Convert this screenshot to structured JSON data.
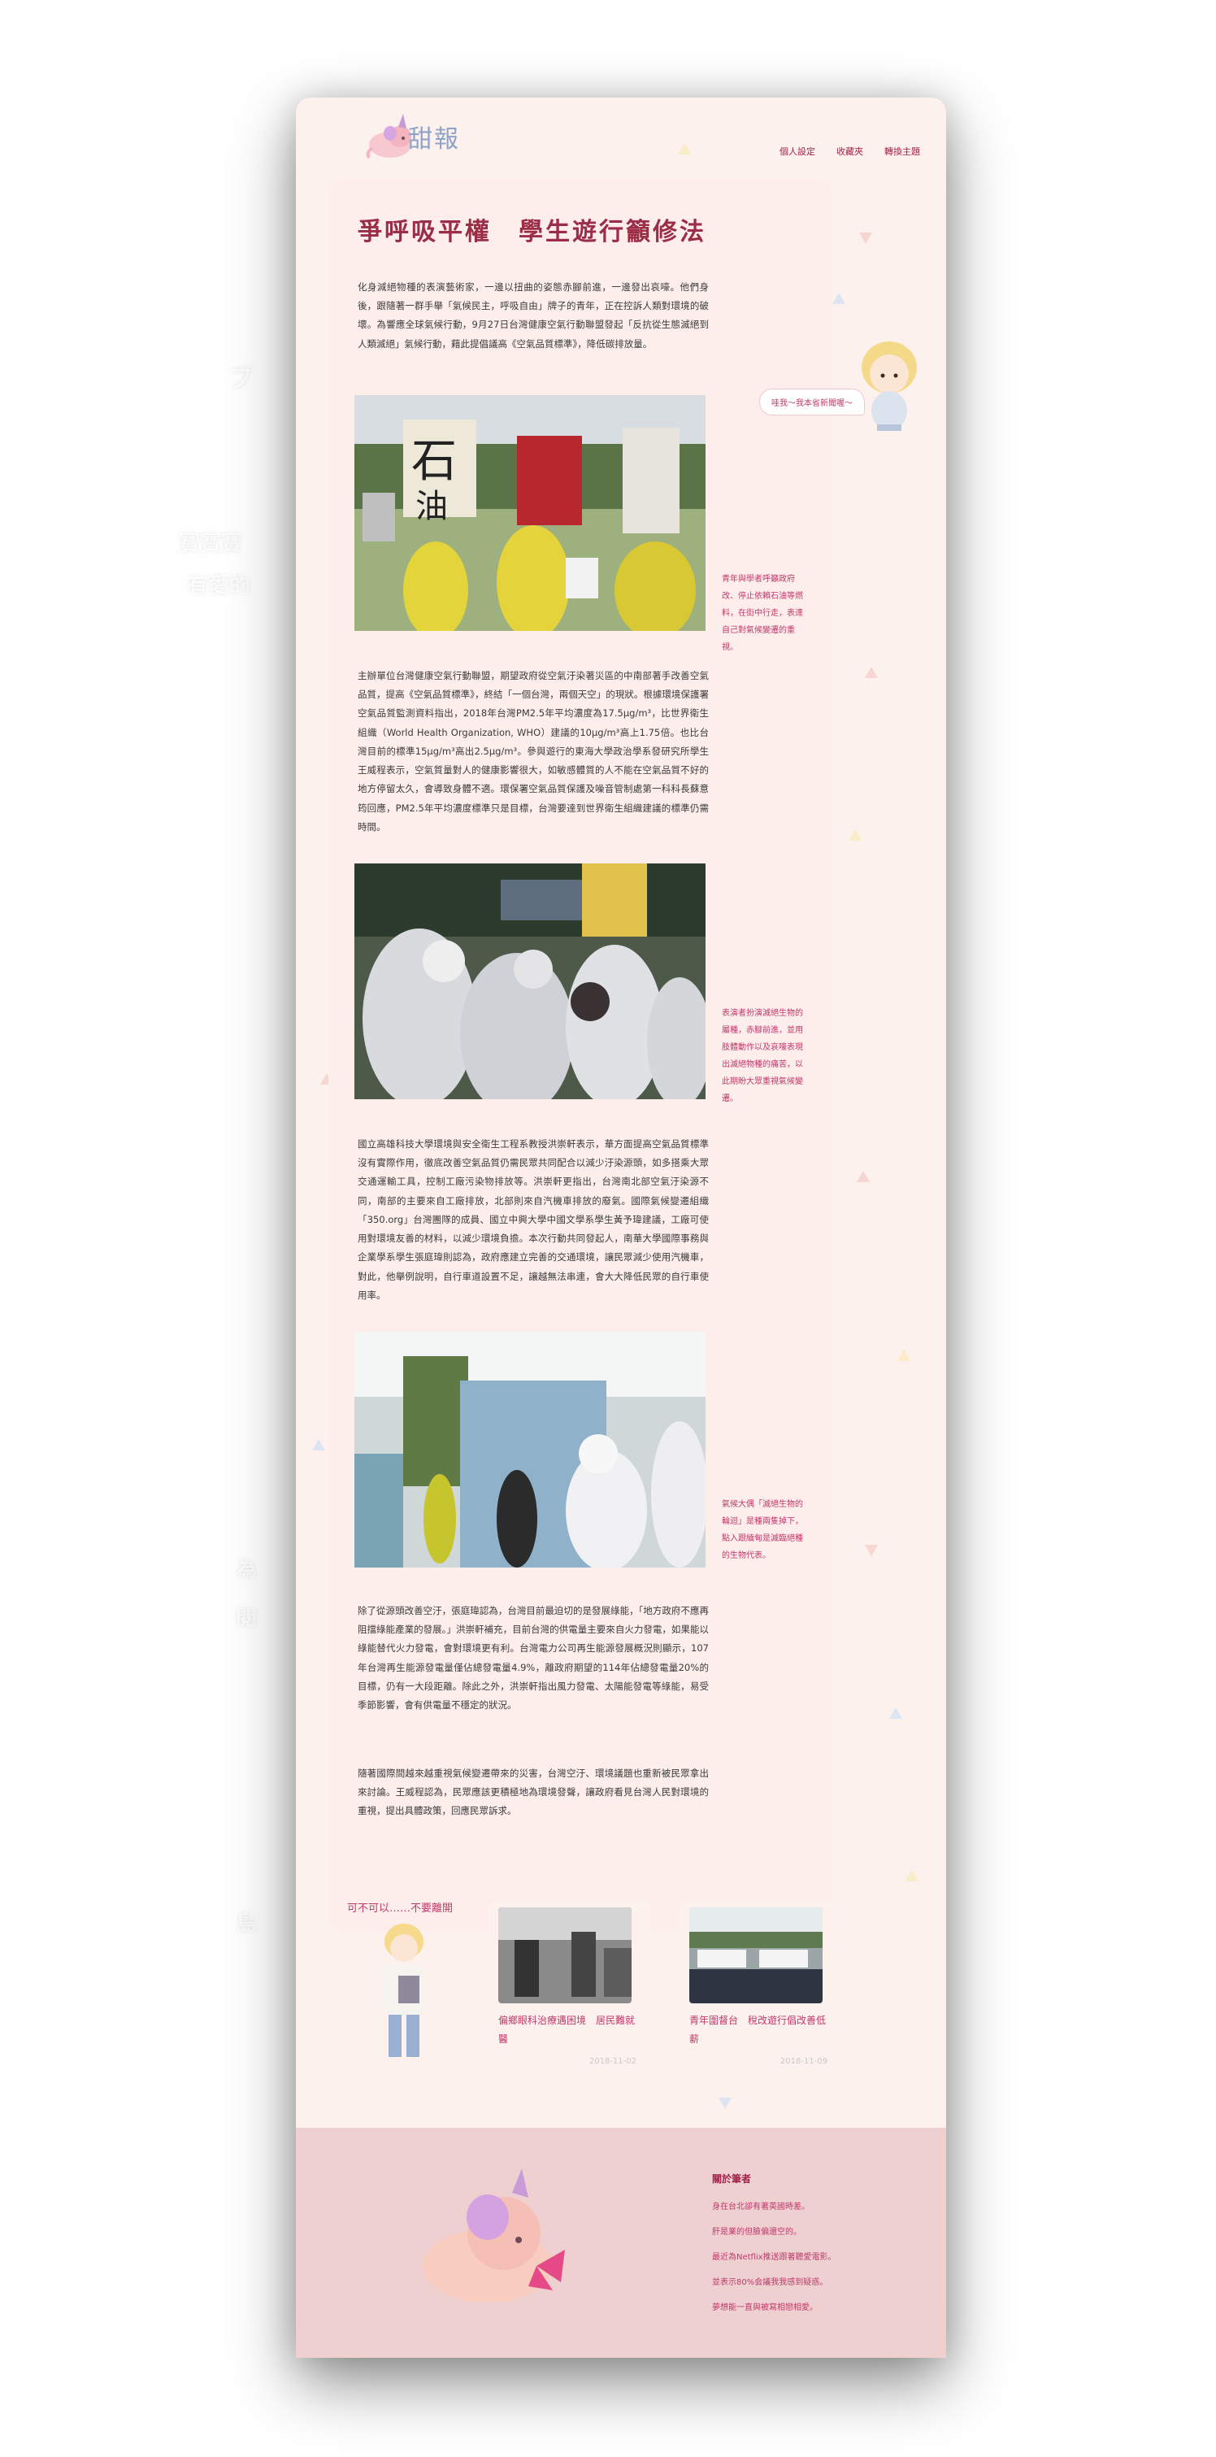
{
  "site": {
    "logo_text": "甜報"
  },
  "nav": [
    {
      "label": "個人設定"
    },
    {
      "label": "收藏夾"
    },
    {
      "label": "轉換主題"
    }
  ],
  "article": {
    "title": "爭呼吸平權　學生遊行籲修法",
    "intro": "化身減絕物種的表演藝術家，一邊以扭曲的姿態赤腳前進，一邊發出哀嚎。他們身後，跟隨著一群手舉「氣候民主，呼吸自由」牌子的青年，正在控訴人類對環境的破壞。為響應全球氣候行動，9月27日台灣健康空氣行動聯盟發起「反抗從生態滅絕到人類滅絕」氣候行動，藉此提倡議高《空氣品質標準》，降低碳排放量。",
    "para2": "主辦單位台灣健康空氣行動聯盟，期望政府從空氣汙染著災區的中南部著手改善空氣品質，提高《空氣品質標準》，終結「一個台灣，兩個天空」的現狀。根據環境保護署空氣品質監測資料指出，2018年台灣PM2.5年平均濃度為17.5μg/m³，比世界衛生組織（World Health Organization, WHO）建議的10μg/m³高上1.75倍。也比台灣目前的標準15μg/m³高出2.5μg/m³。參與遊行的東海大學政治學系發研究所學生王威程表示，空氣質量對人的健康影響很大，如敏感體質的人不能在空氣品質不好的地方停留太久，會導致身體不適。環保署空氣品質保護及噪音管制處第一科科長蘇意筠回應，PM2.5年平均濃度標準只是目標，台灣要達到世界衛生組織建議的標準仍需時間。",
    "para3": "國立高雄科技大學環境與安全衛生工程系教授洪崇軒表示，華方面提高空氣品質標準沒有實際作用，徹底改善空氣品質仍需民眾共同配合以減少汙染源頭，如多搭乘大眾交通運輸工具，控制工廠污染物排放等。洪崇軒更指出，台灣南北部空氣汙染源不同，南部的主要來自工廠排放，北部則來自汽機車排放的廢氣。國際氣候變遷組織「350.org」台灣團隊的成員、國立中興大學中國文學系學生黃予瑋建議，工廠可使用對環境友善的材料，以減少環境負擔。本次行動共同發起人，南華大學國際事務與企業學系學生張庭瑋則認為，政府應建立完善的交通環境，讓民眾減少使用汽機車，對此，他舉例說明，自行車道設置不足，讓越無法串連，會大大降低民眾的自行車使用率。",
    "para4": "除了從源頭改善空汙，張庭瑋認為，台灣目前最迫切的是發展綠能，「地方政府不應再阻擋綠能產業的發展。」洪崇軒補充，目前台灣的供電量主要來自火力發電，如果能以綠能替代火力發電，會對環境更有利。台灣電力公司再生能源發展概況則顯示，107年台灣再生能源發電量僅佔總發電量4.9%，離政府期望的114年佔總發電量20%的目標，仍有一大段距離。除此之外，洪崇軒指出風力發電、太陽能發電等綠能，易受季節影響，會有供電量不穩定的狀況。",
    "para5": "隨著國際間越來越重視氣候變遷帶來的災害，台灣空汙、環境議題也重新被民眾拿出來討論。王威程認為，民眾應該更積極地為環境發聲，讓政府看見台灣人民對環境的重視，提出具體政策，回應民眾訴求。",
    "captions": [
      "青年與學者呼籲政府改、停止依賴石油等燃料，在街中行走，表達自己對氣候變遷的重視。",
      "表演者扮演滅絕生物的屬種，赤腳前進，並用肢體動作以及哀嚎表現出滅絕物種的痛苦，以此期盼大眾重視氣候變遷。",
      "氣候大偶「滅絕生物的輪迴」是種兩隻掉下，點入跟緬甸是滅臨絕種的生物代表。"
    ],
    "speech_bubble": "哇我～我本省新聞喔～"
  },
  "related": {
    "label": "可不可以……不要離開",
    "items": [
      {
        "title": "偏鄉眼科治療遇困境　居民難就醫",
        "date": "2018-11-02"
      },
      {
        "title": "青年圍督台　稅改遊行倡改善低薪",
        "date": "2018-11-09"
      }
    ]
  },
  "footer": {
    "title": "關於筆者",
    "items": [
      "身在台北卻有著英國時差。",
      "肝是業的但臉偏還空的。",
      "最近為Netflix推送跟著聽愛電影。",
      "並表示80%会議我我感到疑惑。",
      "夢想能一直與被寫相戀相愛。"
    ]
  },
  "background_text": [
    "プ",
    "寶寶寶",
    "有愛的",
    "為",
    "閱",
    "島"
  ],
  "colors": {
    "title": "#9c2d46",
    "accent": "#c0396a",
    "card_bg": "#fdf1ee",
    "footer_bg": "#efd0d1"
  }
}
